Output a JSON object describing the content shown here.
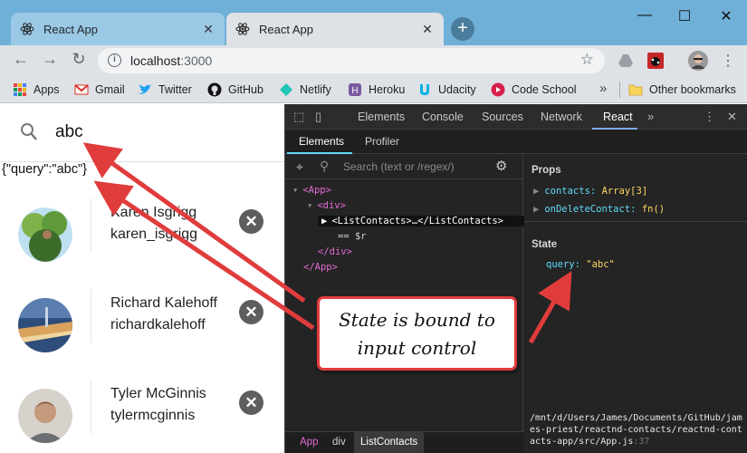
{
  "browser": {
    "tabs": [
      {
        "title": "React App",
        "active": false,
        "icon": "react-icon"
      },
      {
        "title": "React App",
        "active": true,
        "icon": "react-icon"
      }
    ],
    "new_tab_label": "+",
    "window_controls": {
      "minimize": "—",
      "maximize": "☐",
      "close": "✕"
    },
    "url_host": "localhost",
    "url_port": ":3000",
    "bookmarks": [
      {
        "label": "Apps",
        "icon": "apps-grid-icon",
        "color": "#e8453c"
      },
      {
        "label": "Gmail",
        "icon": "gmail-icon",
        "color": "#d93025"
      },
      {
        "label": "Twitter",
        "icon": "twitter-icon",
        "color": "#1da1f2"
      },
      {
        "label": "GitHub",
        "icon": "github-icon",
        "color": "#111111"
      },
      {
        "label": "Netlify",
        "icon": "netlify-icon",
        "color": "#20c6b7"
      },
      {
        "label": "Heroku",
        "icon": "heroku-icon",
        "color": "#79589f"
      },
      {
        "label": "Udacity",
        "icon": "udacity-icon",
        "color": "#02b3e4"
      },
      {
        "label": "Code School",
        "icon": "code-school-icon",
        "color": "#d8204c"
      }
    ],
    "bookmarks_more": "»",
    "other_bookmarks": "Other bookmarks"
  },
  "app": {
    "search_value": "abc",
    "state_json": "{\"query\":\"abc\"}",
    "contacts": [
      {
        "name": "Karen Isgrigg",
        "handle": "karen_isgrigg",
        "photo_colors": [
          "#7fb24a",
          "#3d6b2a"
        ]
      },
      {
        "name": "Richard Kalehoff",
        "handle": "richardkalehoff",
        "photo_colors": [
          "#2f4d7a",
          "#d9a35e"
        ]
      },
      {
        "name": "Tyler McGinnis",
        "handle": "tylermcginnis",
        "photo_colors": [
          "#c49a7c",
          "#6b6f74"
        ]
      }
    ],
    "remove_glyph": "✕"
  },
  "devtools": {
    "tabs": [
      "Elements",
      "Console",
      "Sources",
      "Network",
      "React"
    ],
    "active_tab": "React",
    "overflow": "»",
    "react_subtabs": [
      "Elements",
      "Profiler"
    ],
    "search_placeholder": "Search (text or /regex/)",
    "tree": {
      "line1": "<App>",
      "line2": "<div>",
      "line3": "<ListContacts>…</ListContacts>",
      "line4": "== $r",
      "line5": "</div>",
      "line6": "</App>"
    },
    "props_title": "Props",
    "props": [
      {
        "key": "contacts",
        "value": "Array[3]"
      },
      {
        "key": "onDeleteContact",
        "value": "fn()"
      }
    ],
    "state_title": "State",
    "state": {
      "key": "query",
      "value": "\"abc\""
    },
    "source_path": "/mnt/d/Users/James/Documents/GitHub/james-priest/reactnd-contacts/reactnd-contacts-app/src/App.js",
    "source_line": ":37",
    "breadcrumbs": [
      "App",
      "div",
      "ListContacts"
    ]
  },
  "annotation": {
    "line1": "State is bound to",
    "line2": "input control",
    "color": "#e03c3c"
  }
}
